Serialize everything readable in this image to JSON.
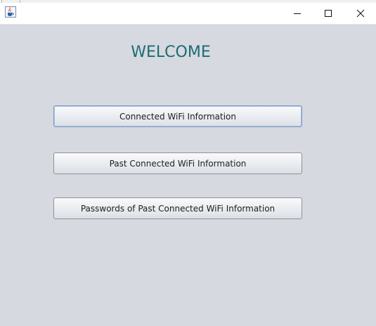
{
  "window": {
    "controls": {
      "minimize_icon": "minimize-icon",
      "maximize_icon": "maximize-icon",
      "close_icon": "close-icon"
    },
    "app_icon": "java-cup-icon"
  },
  "main": {
    "heading": "WELCOME",
    "heading_color": "#1f6b73",
    "background_color": "#d6d9e0",
    "buttons": [
      {
        "label": "Connected WiFi Information",
        "focused": true
      },
      {
        "label": "Past Connected WiFi Information",
        "focused": false
      },
      {
        "label": "Passwords of Past Connected WiFi Information",
        "focused": false
      }
    ]
  }
}
